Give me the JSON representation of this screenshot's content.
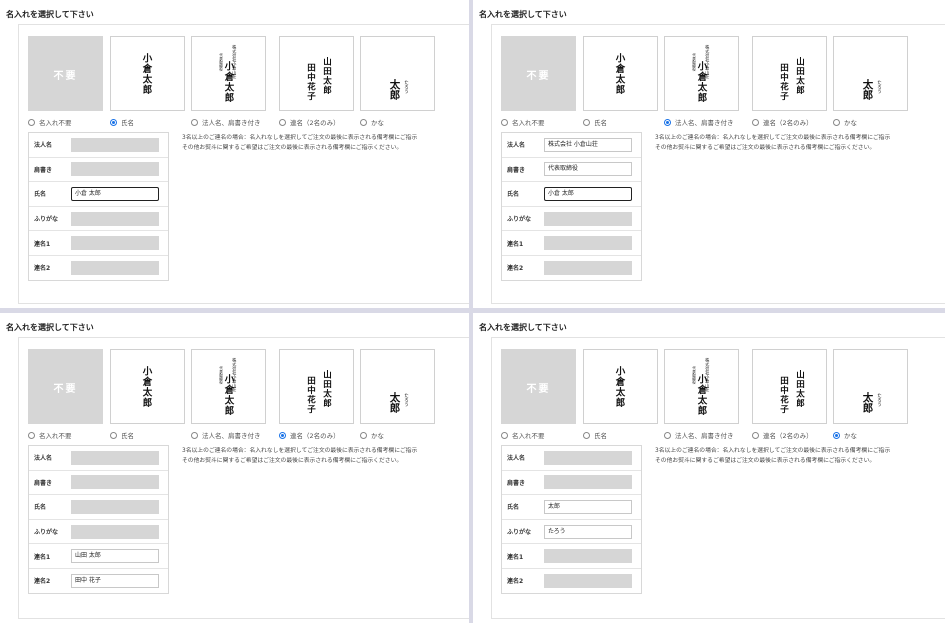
{
  "title": "名入れを選択して下さい",
  "cards": {
    "none_label": "不要",
    "name_card": "小倉太郎",
    "corp_company": "株式会社小倉山荘",
    "corp_role": "代表取締役",
    "corp_name": "小倉太郎",
    "joint_right": "山田太郎",
    "joint_left": "田中花子",
    "kana_kanji": "太郎",
    "kana_reading": "たろう"
  },
  "options": [
    "名入れ不要",
    "氏名",
    "法人名、肩書き付き",
    "連名（2名のみ）",
    "かな"
  ],
  "field_labels": [
    "法人名",
    "肩書き",
    "氏名",
    "ふりがな",
    "連名1",
    "連名2"
  ],
  "note_lines": [
    "3名以上のご連名の場合：名入れなしを選択してご注文の最後に表示される備考欄にご指示",
    "その他お熨斗に関するご希望はご注文の最後に表示される備考欄にご指示ください。"
  ],
  "panels": [
    {
      "selected": 1,
      "values": [
        "",
        "",
        "小倉 太郎",
        "",
        "",
        ""
      ],
      "enabled": [
        false,
        false,
        true,
        false,
        false,
        false
      ],
      "focus": 2
    },
    {
      "selected": 2,
      "values": [
        "株式会社 小倉山荘",
        "代表取締役",
        "小倉 太郎",
        "",
        "",
        ""
      ],
      "enabled": [
        true,
        true,
        true,
        false,
        false,
        false
      ],
      "focus": 2
    },
    {
      "selected": 3,
      "values": [
        "",
        "",
        "",
        "",
        "山田 太郎",
        "田中 花子"
      ],
      "enabled": [
        false,
        false,
        false,
        false,
        true,
        true
      ],
      "focus": -1
    },
    {
      "selected": 4,
      "values": [
        "",
        "",
        "太郎",
        "たろう",
        "",
        ""
      ],
      "enabled": [
        false,
        false,
        true,
        true,
        false,
        false
      ],
      "focus": -1
    }
  ]
}
